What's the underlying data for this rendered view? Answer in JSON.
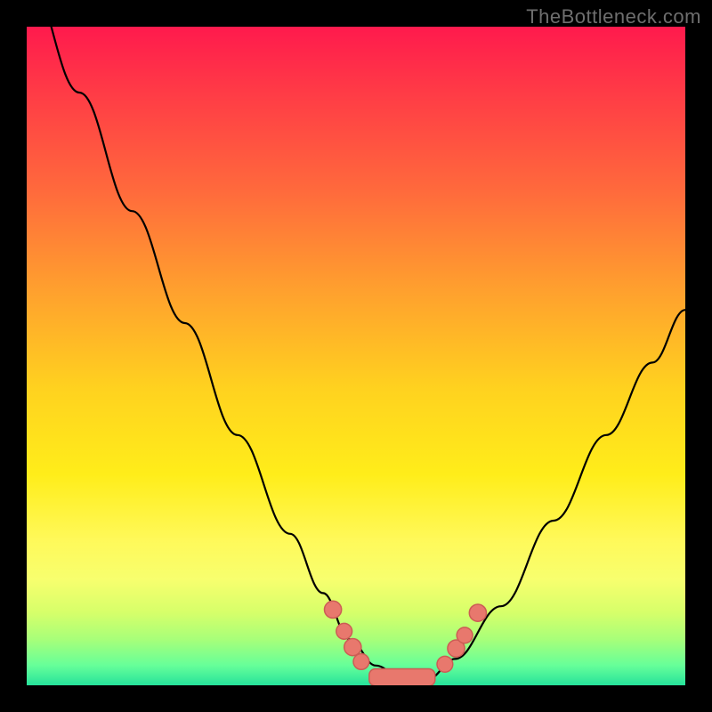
{
  "watermark": "TheBottleneck.com",
  "chart_data": {
    "type": "line",
    "title": "",
    "xlabel": "",
    "ylabel": "",
    "xlim": [
      0,
      100
    ],
    "ylim": [
      0,
      100
    ],
    "axes_visible": false,
    "grid": false,
    "legend": false,
    "background_gradient_stops": [
      {
        "pos": 0,
        "color": "#ff1a4d"
      },
      {
        "pos": 10,
        "color": "#ff3b46"
      },
      {
        "pos": 25,
        "color": "#ff6a3c"
      },
      {
        "pos": 40,
        "color": "#ffa02e"
      },
      {
        "pos": 55,
        "color": "#ffd21f"
      },
      {
        "pos": 68,
        "color": "#ffed1a"
      },
      {
        "pos": 78,
        "color": "#fff95a"
      },
      {
        "pos": 84,
        "color": "#f7ff6e"
      },
      {
        "pos": 89,
        "color": "#d6ff6a"
      },
      {
        "pos": 93,
        "color": "#a8ff79"
      },
      {
        "pos": 97,
        "color": "#66ff99"
      },
      {
        "pos": 100,
        "color": "#26e29b"
      }
    ],
    "series": [
      {
        "name": "bottleneck-curve",
        "x": [
          0,
          8,
          16,
          24,
          32,
          40,
          45,
          49,
          53,
          57,
          61,
          65,
          72,
          80,
          88,
          95,
          100
        ],
        "y": [
          108,
          90,
          72,
          55,
          38,
          23,
          14,
          7,
          3,
          1,
          1,
          4,
          12,
          25,
          38,
          49,
          57
        ]
      }
    ],
    "markers": [
      {
        "x": 46.5,
        "y": 11.5,
        "r": 1.3
      },
      {
        "x": 48.2,
        "y": 8.2,
        "r": 1.2
      },
      {
        "x": 49.5,
        "y": 5.8,
        "r": 1.3
      },
      {
        "x": 50.8,
        "y": 3.6,
        "r": 1.2
      },
      {
        "x": 63.5,
        "y": 3.2,
        "r": 1.2
      },
      {
        "x": 65.2,
        "y": 5.6,
        "r": 1.3
      },
      {
        "x": 66.5,
        "y": 7.6,
        "r": 1.2
      },
      {
        "x": 68.5,
        "y": 11.0,
        "r": 1.3
      }
    ],
    "plateau": {
      "x0": 52.0,
      "x1": 62.0,
      "y": 1.2,
      "thickness": 2.6
    }
  }
}
